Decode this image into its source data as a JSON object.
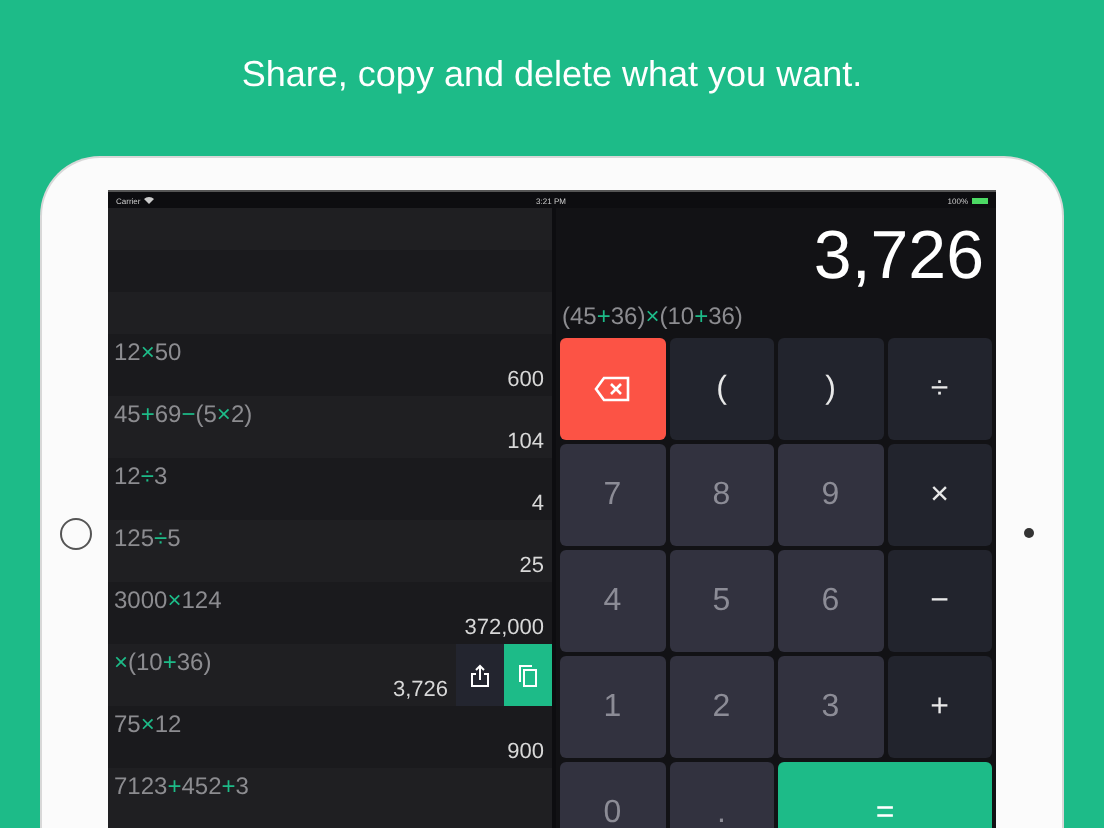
{
  "headline": "Share, copy and delete what you want.",
  "status_bar": {
    "carrier": "Carrier",
    "time": "3:21 PM",
    "battery": "100%"
  },
  "history": [
    {
      "expression": [
        {
          "kind": "num",
          "text": "12"
        },
        {
          "kind": "op",
          "text": "×"
        },
        {
          "kind": "num",
          "text": "50"
        }
      ],
      "result": "600",
      "swiped": false
    },
    {
      "expression": [
        {
          "kind": "num",
          "text": "45"
        },
        {
          "kind": "op",
          "text": "+"
        },
        {
          "kind": "num",
          "text": "69"
        },
        {
          "kind": "op",
          "text": "−"
        },
        {
          "kind": "num",
          "text": "(5"
        },
        {
          "kind": "op",
          "text": "×"
        },
        {
          "kind": "num",
          "text": "2)"
        }
      ],
      "result": "104",
      "swiped": false
    },
    {
      "expression": [
        {
          "kind": "num",
          "text": "12"
        },
        {
          "kind": "op",
          "text": "÷"
        },
        {
          "kind": "num",
          "text": "3"
        }
      ],
      "result": "4",
      "swiped": false
    },
    {
      "expression": [
        {
          "kind": "num",
          "text": "125"
        },
        {
          "kind": "op",
          "text": "÷"
        },
        {
          "kind": "num",
          "text": "5"
        }
      ],
      "result": "25",
      "swiped": false
    },
    {
      "expression": [
        {
          "kind": "num",
          "text": "3000"
        },
        {
          "kind": "op",
          "text": "×"
        },
        {
          "kind": "num",
          "text": "124"
        }
      ],
      "result": "372,000",
      "swiped": false
    },
    {
      "expression": [
        {
          "kind": "op",
          "text": "×"
        },
        {
          "kind": "num",
          "text": "(10"
        },
        {
          "kind": "op",
          "text": "+"
        },
        {
          "kind": "num",
          "text": "36)"
        }
      ],
      "result": "3,726",
      "swiped": true
    },
    {
      "expression": [
        {
          "kind": "num",
          "text": "75"
        },
        {
          "kind": "op",
          "text": "×"
        },
        {
          "kind": "num",
          "text": "12"
        }
      ],
      "result": "900",
      "swiped": false
    },
    {
      "expression": [
        {
          "kind": "num",
          "text": "7123"
        },
        {
          "kind": "op",
          "text": "+"
        },
        {
          "kind": "num",
          "text": "452"
        },
        {
          "kind": "op",
          "text": "+"
        },
        {
          "kind": "num",
          "text": "3"
        }
      ],
      "swiped": false
    }
  ],
  "display": {
    "value": "3,726",
    "expression": [
      {
        "kind": "num",
        "text": "(45"
      },
      {
        "kind": "op",
        "text": "+"
      },
      {
        "kind": "num",
        "text": "36)"
      },
      {
        "kind": "op",
        "text": "×"
      },
      {
        "kind": "num",
        "text": "(10"
      },
      {
        "kind": "op",
        "text": "+"
      },
      {
        "kind": "num",
        "text": "36)"
      }
    ]
  },
  "keys": [
    {
      "kind": "backspace"
    },
    {
      "kind": "paren",
      "label": "("
    },
    {
      "kind": "paren",
      "label": ")"
    },
    {
      "kind": "op",
      "label": "÷"
    },
    {
      "kind": "digit",
      "label": "7"
    },
    {
      "kind": "digit",
      "label": "8"
    },
    {
      "kind": "digit",
      "label": "9"
    },
    {
      "kind": "op",
      "label": "×"
    },
    {
      "kind": "digit",
      "label": "4"
    },
    {
      "kind": "digit",
      "label": "5"
    },
    {
      "kind": "digit",
      "label": "6"
    },
    {
      "kind": "op",
      "label": "−"
    },
    {
      "kind": "digit",
      "label": "1"
    },
    {
      "kind": "digit",
      "label": "2"
    },
    {
      "kind": "digit",
      "label": "3"
    },
    {
      "kind": "op",
      "label": "+"
    },
    {
      "kind": "digit",
      "label": "0"
    },
    {
      "kind": "digit",
      "label": "."
    },
    {
      "kind": "equals",
      "label": "="
    }
  ]
}
